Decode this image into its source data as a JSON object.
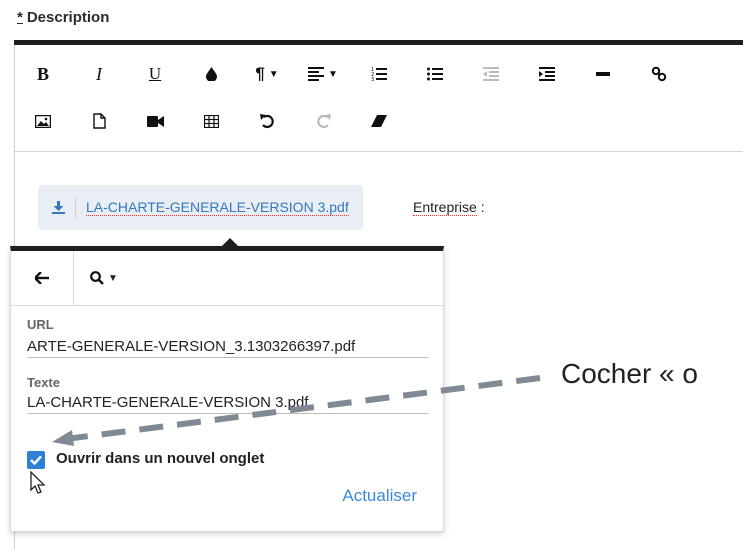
{
  "field": {
    "required_mark": "*",
    "label": "Description"
  },
  "toolbar": {
    "row1": [
      {
        "name": "bold-button",
        "icon": "bold",
        "text": "B"
      },
      {
        "name": "italic-button",
        "icon": "italic",
        "text": "I"
      },
      {
        "name": "underline-button",
        "icon": "underline",
        "text": "U"
      },
      {
        "name": "color-button",
        "icon": "drop-icon"
      },
      {
        "name": "paragraph-button",
        "icon": "pilcrow-icon",
        "text": "¶"
      },
      {
        "name": "align-button",
        "icon": "align-icon"
      },
      {
        "name": "ordered-list-button",
        "icon": "ordered-list-icon"
      },
      {
        "name": "unordered-list-button",
        "icon": "unordered-list-icon"
      },
      {
        "name": "outdent-button",
        "icon": "outdent-icon"
      },
      {
        "name": "indent-button",
        "icon": "indent-icon"
      },
      {
        "name": "horizontal-rule-button",
        "icon": "hr-icon"
      },
      {
        "name": "link-button",
        "icon": "link-icon"
      }
    ],
    "row2": [
      {
        "name": "image-button",
        "icon": "image-icon"
      },
      {
        "name": "file-button",
        "icon": "file-icon"
      },
      {
        "name": "video-button",
        "icon": "video-icon"
      },
      {
        "name": "table-button",
        "icon": "table-icon"
      },
      {
        "name": "undo-button",
        "icon": "undo-icon"
      },
      {
        "name": "redo-button",
        "icon": "redo-icon"
      },
      {
        "name": "eraser-button",
        "icon": "eraser-icon"
      }
    ]
  },
  "content": {
    "attachment_name": "LA-CHARTE-GENERALE-VERSION 3.pdf",
    "after_text_word": "Entreprise",
    "after_text_colon": " :"
  },
  "link_popup": {
    "url_label": "URL",
    "url_value": "ARTE-GENERALE-VERSION_3.1303266397.pdf",
    "text_label": "Texte",
    "text_value": "LA-CHARTE-GENERALE-VERSION 3.pdf",
    "new_tab_label": "Ouvrir dans un nouvel onglet",
    "new_tab_checked": true,
    "update_label": "Actualiser"
  },
  "annotation": {
    "text": "Cocher « o"
  },
  "colors": {
    "accent": "#2f7fd6",
    "link": "#3477c1",
    "arrow": "#7f8a95"
  }
}
